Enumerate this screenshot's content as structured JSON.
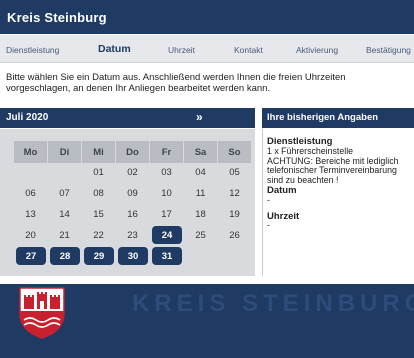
{
  "header": {
    "title": "Kreis Steinburg"
  },
  "steps": [
    {
      "label": "Dienstleistung"
    },
    {
      "label": "Datum"
    },
    {
      "label": "Uhrzeit"
    },
    {
      "label": "Kontakt"
    },
    {
      "label": "Aktivierung"
    },
    {
      "label": "Bestätigung"
    }
  ],
  "intro": "Bitte wählen Sie ein Datum aus. Anschließend werden Ihnen die freien Uhrzeiten vorgeschlagen, an denen Ihr Anliegen bearbeitet werden kann.",
  "calendar": {
    "month": "Juli 2020",
    "next": "»",
    "weekdays": [
      "Mo",
      "Di",
      "Mi",
      "Do",
      "Fr",
      "Sa",
      "So"
    ],
    "days": [
      "",
      "",
      "01",
      "02",
      "03",
      "04",
      "05",
      "06",
      "07",
      "08",
      "09",
      "10",
      "11",
      "12",
      "13",
      "14",
      "15",
      "16",
      "17",
      "18",
      "19",
      "20",
      "21",
      "22",
      "23",
      "24",
      "25",
      "26",
      "27",
      "28",
      "29",
      "30",
      "31"
    ],
    "available": [
      "24",
      "27",
      "28",
      "29",
      "30",
      "31"
    ]
  },
  "summary": {
    "title": "Ihre bisherigen Angaben",
    "service_label": "Dienstleistung",
    "service_value": "1 x Führerscheinstelle",
    "note_lines": [
      "ACHTUNG: Bereiche mit lediglich",
      "telefonischer Terminvereinbarung",
      "sind zu beachten !"
    ],
    "date_label": "Datum",
    "date_value": "-",
    "time_label": "Uhrzeit",
    "time_value": "-"
  },
  "footer": {
    "brand": "KREIS STEINBURG"
  },
  "colors": {
    "primary": "#1f3a63",
    "calendar_bg": "#d9dadd",
    "weekday_bg": "#b9bcc2"
  },
  "icons": {
    "next": "chevron-double-right-icon",
    "crest": "coat-of-arms-icon"
  }
}
